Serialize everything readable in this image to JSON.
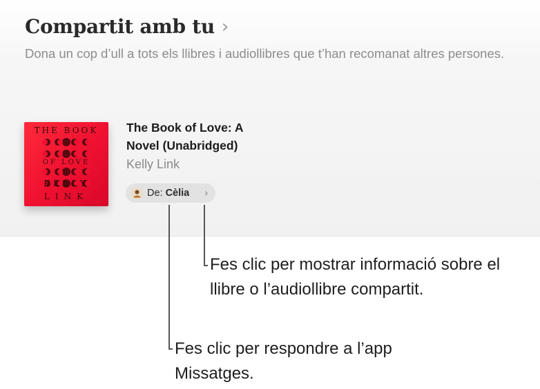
{
  "section": {
    "title": "Compartit amb tu",
    "chevron": "›",
    "subtitle": "Dona un cop d’ull a tots els llibres i audiollibres que t’han recomanat altres persones."
  },
  "book": {
    "cover_text": {
      "line1": "THE BOOK",
      "line2": "OF LOVE",
      "line3": "KELLY",
      "line4": "LINK"
    },
    "title": "The Book of Love: A Novel (Unabridged)",
    "author": "Kelly Link",
    "from": {
      "prefix": "De:",
      "name": "Cèlia",
      "chevron": "›"
    }
  },
  "callouts": {
    "info": "Fes clic per mostrar informació sobre el llibre o l’audiollibre compartit.",
    "messages": "Fes clic per respondre a l’app Missatges."
  },
  "colors": {
    "cover_red": "#ef1030",
    "pill_bg": "#e2e2e2",
    "panel_bg": "#f1f1f1"
  }
}
